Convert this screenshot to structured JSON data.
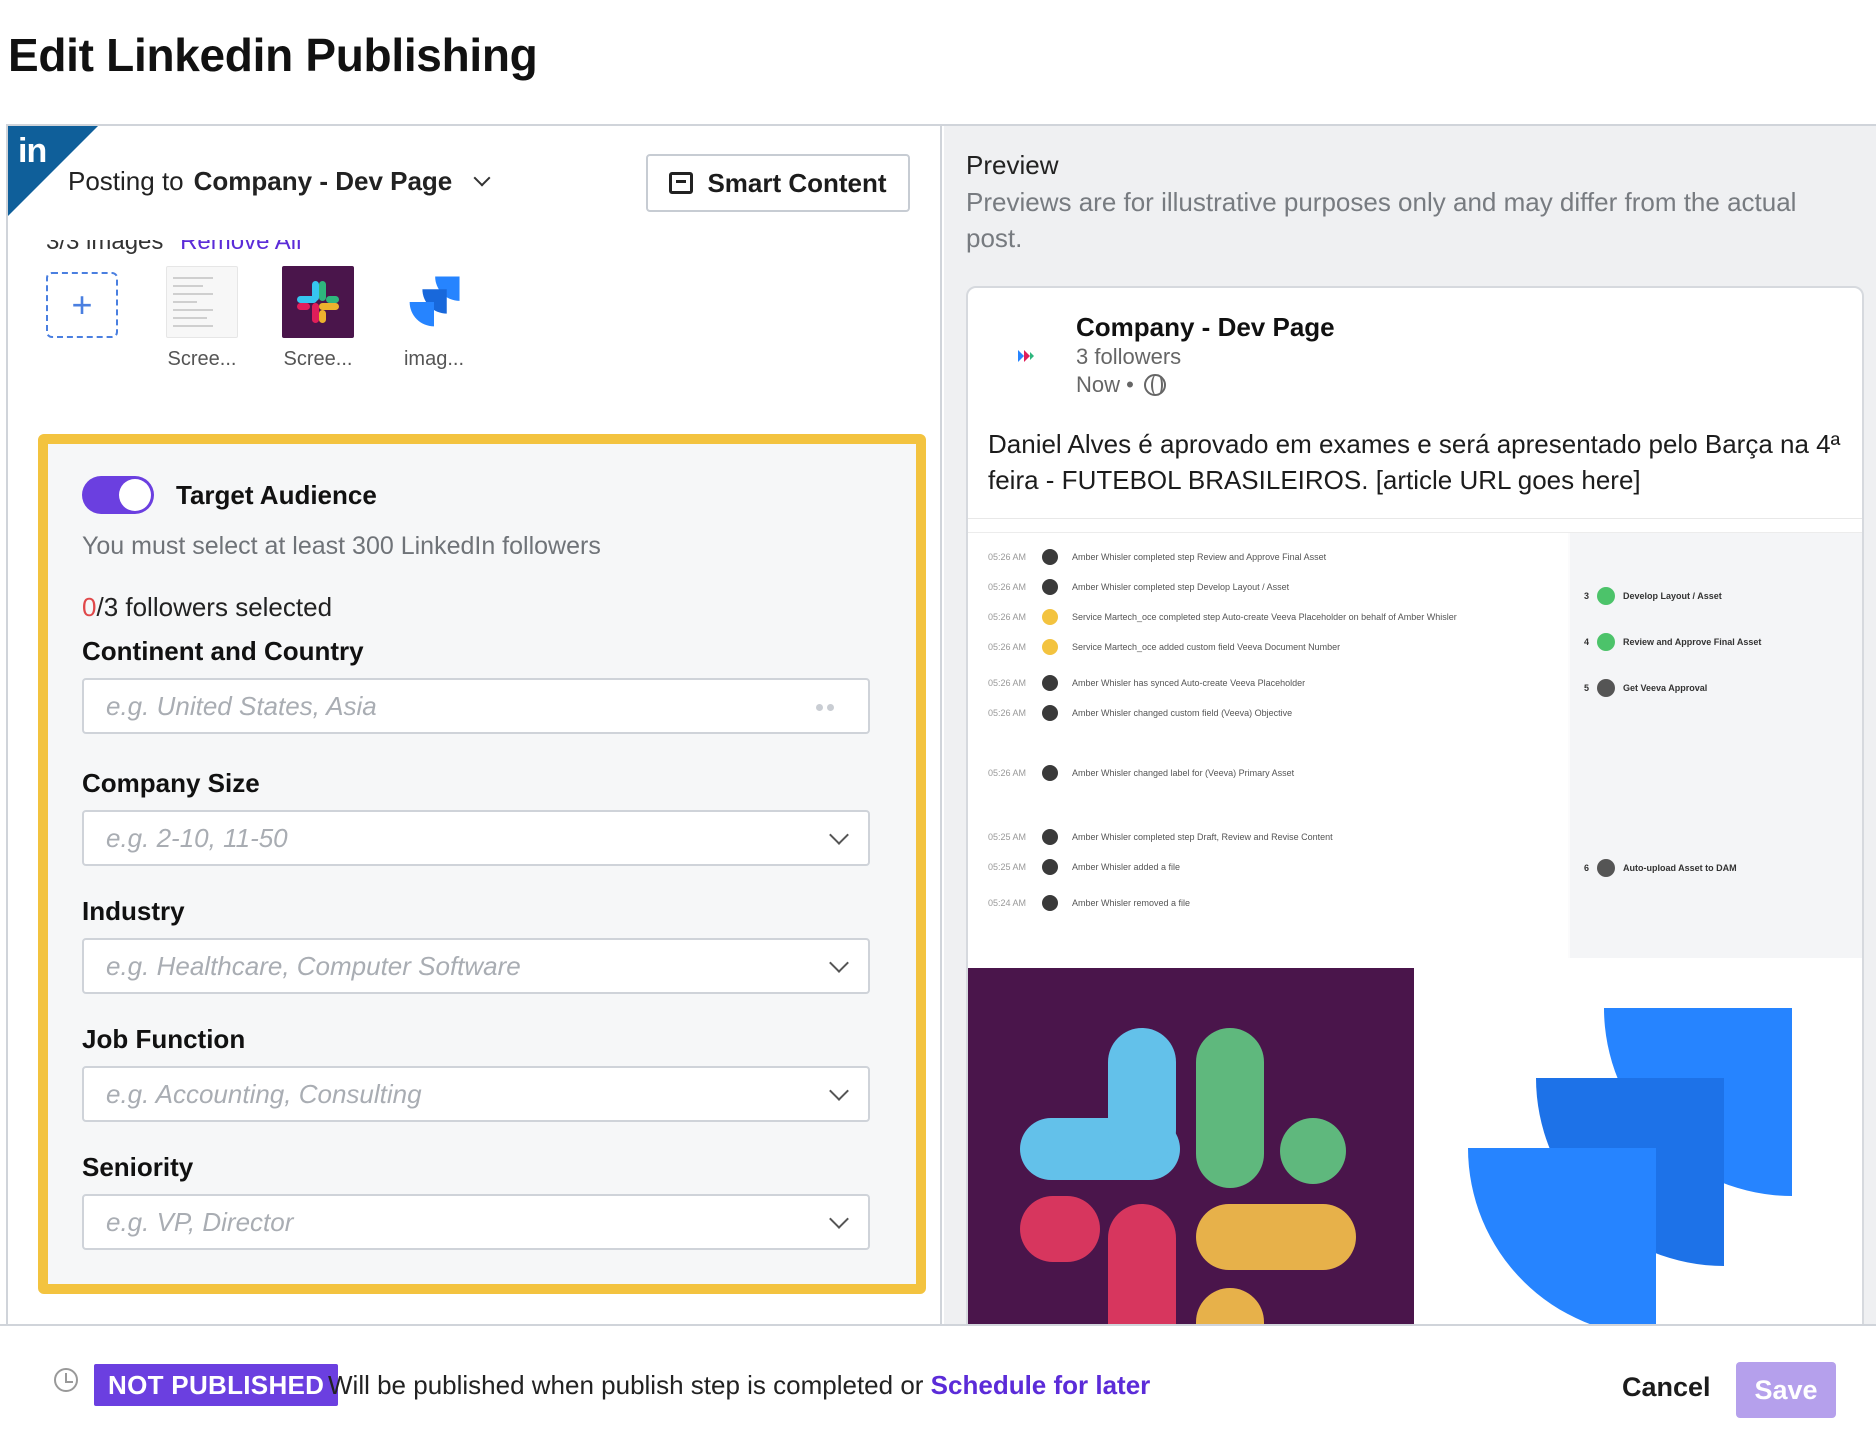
{
  "page": {
    "title": "Edit Linkedin Publishing"
  },
  "left": {
    "network_badge": "in",
    "posting_prefix": "Posting to",
    "posting_target": "Company - Dev Page",
    "smart_content_label": "Smart Content",
    "images_count_text": "3/3 images",
    "remove_all_label": "Remove All",
    "add_image_symbol": "+",
    "thumbnails": [
      {
        "label": "Scree..."
      },
      {
        "label": "Scree..."
      },
      {
        "label": "imag..."
      }
    ]
  },
  "audience": {
    "title": "Target Audience",
    "hint": "You must select at least 300 LinkedIn followers",
    "followers_selected": "0",
    "followers_rest": "/3 followers selected",
    "fields": [
      {
        "label": "Continent and Country",
        "placeholder": "e.g. United States, Asia"
      },
      {
        "label": "Company Size",
        "placeholder": "e.g. 2-10, 11-50"
      },
      {
        "label": "Industry",
        "placeholder": "e.g. Healthcare, Computer Software"
      },
      {
        "label": "Job Function",
        "placeholder": "e.g. Accounting, Consulting"
      },
      {
        "label": "Seniority",
        "placeholder": "e.g. VP, Director"
      }
    ]
  },
  "preview": {
    "title": "Preview",
    "note": "Previews are for illustrative purposes only and may differ from the actual post.",
    "company": "Company - Dev Page",
    "followers": "3 followers",
    "time": "Now •",
    "text": "Daniel Alves é aprovado em exames e será apresentado pelo Barça na 4ª feira - FUTEBOL BRASILEIROS. [article URL goes here]",
    "screenshot": {
      "activity": [
        {
          "time": "05:26 AM",
          "text": "Amber Whisler completed step Review and Approve Final Asset"
        },
        {
          "time": "05:26 AM",
          "text": "Amber Whisler completed step Develop Layout / Asset"
        },
        {
          "time": "05:26 AM",
          "text": "Service Martech_oce completed step Auto-create Veeva Placeholder on behalf of Amber Whisler"
        },
        {
          "time": "05:26 AM",
          "text": "Service Martech_oce added custom field Veeva Document Number"
        },
        {
          "time": "05:26 AM",
          "text": "Amber Whisler has synced Auto-create Veeva Placeholder"
        },
        {
          "time": "05:26 AM",
          "text": "Amber Whisler changed custom field (Veeva) Objective"
        },
        {
          "time": "05:26 AM",
          "text": "Amber Whisler changed label for (Veeva) Primary Asset"
        },
        {
          "time": "05:25 AM",
          "text": "Amber Whisler completed step Draft, Review and Revise Content"
        },
        {
          "time": "05:25 AM",
          "text": "Amber Whisler added a file"
        },
        {
          "time": "05:24 AM",
          "text": "Amber Whisler removed a file"
        }
      ],
      "steps": [
        {
          "num": "3",
          "text": "Develop Layout / Asset"
        },
        {
          "num": "4",
          "text": "Review and Approve Final Asset"
        },
        {
          "num": "5",
          "text": "Get Veeva Approval"
        },
        {
          "num": "6",
          "text": "Auto-upload Asset to DAM"
        }
      ]
    }
  },
  "footer": {
    "status": "NOT PUBLISHED",
    "message": "Will be published when publish step is completed or",
    "schedule_link": "Schedule for later",
    "cancel_label": "Cancel",
    "save_label": "Save"
  },
  "colors": {
    "accent": "#6b3fe0",
    "highlight_border": "#f3c33f",
    "linkedin_blue": "#0f5f9a",
    "error_red": "#e0484a"
  }
}
